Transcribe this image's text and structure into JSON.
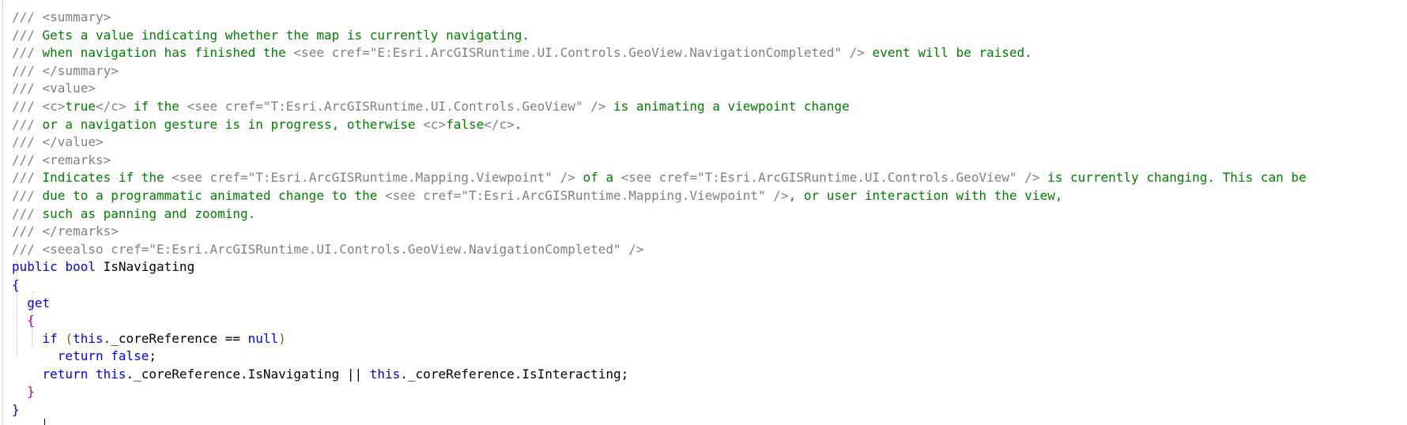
{
  "editor": {
    "lines": [
      [
        {
          "t": "/// ",
          "c": "gray"
        },
        {
          "t": "<summary>",
          "c": "gray"
        }
      ],
      [
        {
          "t": "/// ",
          "c": "gray"
        },
        {
          "t": "Gets a value indicating whether the map is currently navigating.",
          "c": "green"
        }
      ],
      [
        {
          "t": "/// ",
          "c": "gray"
        },
        {
          "t": "when navigation has finished the ",
          "c": "green"
        },
        {
          "t": "<see cref=\"E:Esri.ArcGISRuntime.UI.Controls.GeoView.NavigationCompleted\" />",
          "c": "gray"
        },
        {
          "t": " event will be raised.",
          "c": "green"
        }
      ],
      [
        {
          "t": "/// ",
          "c": "gray"
        },
        {
          "t": "</summary>",
          "c": "gray"
        }
      ],
      [
        {
          "t": "/// ",
          "c": "gray"
        },
        {
          "t": "<value>",
          "c": "gray"
        }
      ],
      [
        {
          "t": "/// ",
          "c": "gray"
        },
        {
          "t": "<c>",
          "c": "gray"
        },
        {
          "t": "true",
          "c": "green"
        },
        {
          "t": "</c>",
          "c": "gray"
        },
        {
          "t": " if the ",
          "c": "green"
        },
        {
          "t": "<see cref=\"T:Esri.ArcGISRuntime.UI.Controls.GeoView\" />",
          "c": "gray"
        },
        {
          "t": " is animating a viewpoint change",
          "c": "green"
        }
      ],
      [
        {
          "t": "/// ",
          "c": "gray"
        },
        {
          "t": "or a navigation gesture is in progress, otherwise ",
          "c": "green"
        },
        {
          "t": "<c>",
          "c": "gray"
        },
        {
          "t": "false",
          "c": "green"
        },
        {
          "t": "</c>",
          "c": "gray"
        },
        {
          "t": ".",
          "c": "green"
        }
      ],
      [
        {
          "t": "/// ",
          "c": "gray"
        },
        {
          "t": "</value>",
          "c": "gray"
        }
      ],
      [
        {
          "t": "/// ",
          "c": "gray"
        },
        {
          "t": "<remarks>",
          "c": "gray"
        }
      ],
      [
        {
          "t": "/// ",
          "c": "gray"
        },
        {
          "t": "Indicates if the ",
          "c": "green"
        },
        {
          "t": "<see cref=\"T:Esri.ArcGISRuntime.Mapping.Viewpoint\" />",
          "c": "gray"
        },
        {
          "t": " of a ",
          "c": "green"
        },
        {
          "t": "<see cref=\"T:Esri.ArcGISRuntime.UI.Controls.GeoView\" />",
          "c": "gray"
        },
        {
          "t": " is currently changing. This can be",
          "c": "green"
        }
      ],
      [
        {
          "t": "/// ",
          "c": "gray"
        },
        {
          "t": "due to a programmatic animated change to the ",
          "c": "green"
        },
        {
          "t": "<see cref=\"T:Esri.ArcGISRuntime.Mapping.Viewpoint\" />",
          "c": "gray"
        },
        {
          "t": ", or user interaction with the view,",
          "c": "green"
        }
      ],
      [
        {
          "t": "/// ",
          "c": "gray"
        },
        {
          "t": "such as panning and zooming.",
          "c": "green"
        }
      ],
      [
        {
          "t": "/// ",
          "c": "gray"
        },
        {
          "t": "</remarks>",
          "c": "gray"
        }
      ],
      [
        {
          "t": "/// ",
          "c": "gray"
        },
        {
          "t": "<seealso cref=\"E:Esri.ArcGISRuntime.UI.Controls.GeoView.NavigationCompleted\" />",
          "c": "gray"
        }
      ],
      [
        {
          "t": "public",
          "c": "kw"
        },
        {
          "t": " ",
          "c": "plain"
        },
        {
          "t": "bool",
          "c": "kw"
        },
        {
          "t": " IsNavigating",
          "c": "plain"
        }
      ],
      [
        {
          "t": "{",
          "c": "br1"
        }
      ],
      [
        {
          "t": "  ",
          "c": "plain"
        },
        {
          "t": "get",
          "c": "kw"
        }
      ],
      [
        {
          "t": "  ",
          "c": "plain"
        },
        {
          "t": "{",
          "c": "br2m"
        }
      ],
      [
        {
          "t": "    ",
          "c": "plain"
        },
        {
          "t": "if",
          "c": "kw"
        },
        {
          "t": " ",
          "c": "plain"
        },
        {
          "t": "(",
          "c": "br3"
        },
        {
          "t": "this",
          "c": "kw"
        },
        {
          "t": "._coreReference == ",
          "c": "plain"
        },
        {
          "t": "null",
          "c": "kw"
        },
        {
          "t": ")",
          "c": "br3"
        }
      ],
      [
        {
          "t": "      ",
          "c": "plain"
        },
        {
          "t": "return",
          "c": "kw"
        },
        {
          "t": " ",
          "c": "plain"
        },
        {
          "t": "false",
          "c": "kw"
        },
        {
          "t": ";",
          "c": "plain"
        }
      ],
      [
        {
          "t": "    ",
          "c": "plain"
        },
        {
          "t": "return",
          "c": "kw"
        },
        {
          "t": " ",
          "c": "plain"
        },
        {
          "t": "this",
          "c": "kw"
        },
        {
          "t": "._coreReference.IsNavigating || ",
          "c": "plain"
        },
        {
          "t": "this",
          "c": "kw"
        },
        {
          "t": "._coreReference.IsInteracting;",
          "c": "plain"
        }
      ],
      [
        {
          "t": "  ",
          "c": "plain"
        },
        {
          "t": "}",
          "c": "br2m"
        }
      ],
      [
        {
          "t": "}",
          "c": "br1"
        }
      ]
    ]
  }
}
